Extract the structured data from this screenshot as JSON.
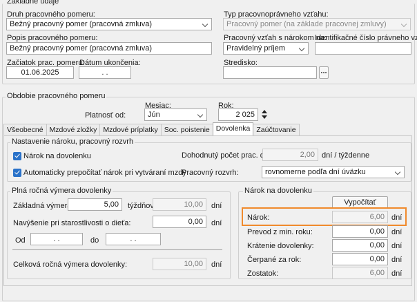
{
  "sections": {
    "zakladne": "Základné údaje",
    "obdobie": "Obdobie pracovného pomeru"
  },
  "druh": {
    "label": "Druh pracovného pomeru:",
    "value": "Bežný pracovný pomer (pracovná zmluva)"
  },
  "typ": {
    "label": "Typ pracovnoprávneho vzťahu:",
    "value": "Pracovný pomer (na základe pracovnej zmluvy)"
  },
  "popis": {
    "label": "Popis pracovného pomeru:",
    "value": "Bežný pracovný pomer (pracovná zmluva)"
  },
  "vztah": {
    "label": "Pracovný vzťah s nárokom na:",
    "value": "Pravidelný príjem"
  },
  "icpv": {
    "label": "Identifikačné číslo právneho vzťahu:",
    "value": ""
  },
  "zaciatok": {
    "label": "Začiatok prac. pomeru:",
    "value": "01.06.2025"
  },
  "ukoncenie": {
    "label": "Dátum ukončenia:",
    "value": " .   . "
  },
  "stredisko": {
    "label": "Stredisko:",
    "value": "",
    "button": "..."
  },
  "platnost": {
    "label": "Platnosť od:"
  },
  "mesiac": {
    "label": "Mesiac:",
    "value": "Jún"
  },
  "rok": {
    "label": "Rok:",
    "value": "2 025"
  },
  "tabs": [
    {
      "label": "Všeobecné"
    },
    {
      "label": "Mzdové zložky"
    },
    {
      "label": "Mzdové príplatky"
    },
    {
      "label": "Soc. poistenie"
    },
    {
      "label": "Dovolenka"
    },
    {
      "label": "Zaúčtovanie"
    }
  ],
  "nastavenie": {
    "title": "Nastavenie nároku, pracovný rozvrh",
    "narok_cb": "Nárok na dovolenku",
    "auto_cb": "Automaticky prepočítať nárok pri vytváraní mzdy",
    "dohodnuty_label": "Dohodnutý počet prac. dní:",
    "dohodnuty_value": "2,00",
    "dohodnuty_unit": "dní / týždenne",
    "rozvrh_label": "Pracovný rozvrh:",
    "rozvrh_value": "rovnomerne podľa dní úväzku"
  },
  "plna": {
    "title": "Plná ročná výmera dovolenky",
    "zakladna_label": "Základná výmera:",
    "zakladna_value": "5,00",
    "tyzdnov": "týždňov",
    "zakladna_dni": "10,00",
    "dni": "dní",
    "navysenie_label": "Navýšenie pri starostlivosti o dieťa:",
    "navysenie_value": "0,00",
    "od_label": "Od",
    "od_value": " .   . ",
    "do_label": "do",
    "do_value": " .   . ",
    "celkova_label": "Celková ročná výmera dovolenky:",
    "celkova_value": "10,00"
  },
  "narok_panel": {
    "title": "Nárok na dovolenku",
    "button": "Vypočítať",
    "dni": "dní",
    "rows": [
      {
        "label": "Nárok:",
        "value": "6,00"
      },
      {
        "label": "Prevod z min. roku:",
        "value": "0,00"
      },
      {
        "label": "Krátenie dovolenky:",
        "value": "0,00"
      },
      {
        "label": "Čerpané za rok:",
        "value": "0,00"
      },
      {
        "label": "Zostatok:",
        "value": "6,00"
      }
    ]
  },
  "colors": {
    "highlight": "#f08a2c",
    "checkbox": "#2a72c9"
  }
}
